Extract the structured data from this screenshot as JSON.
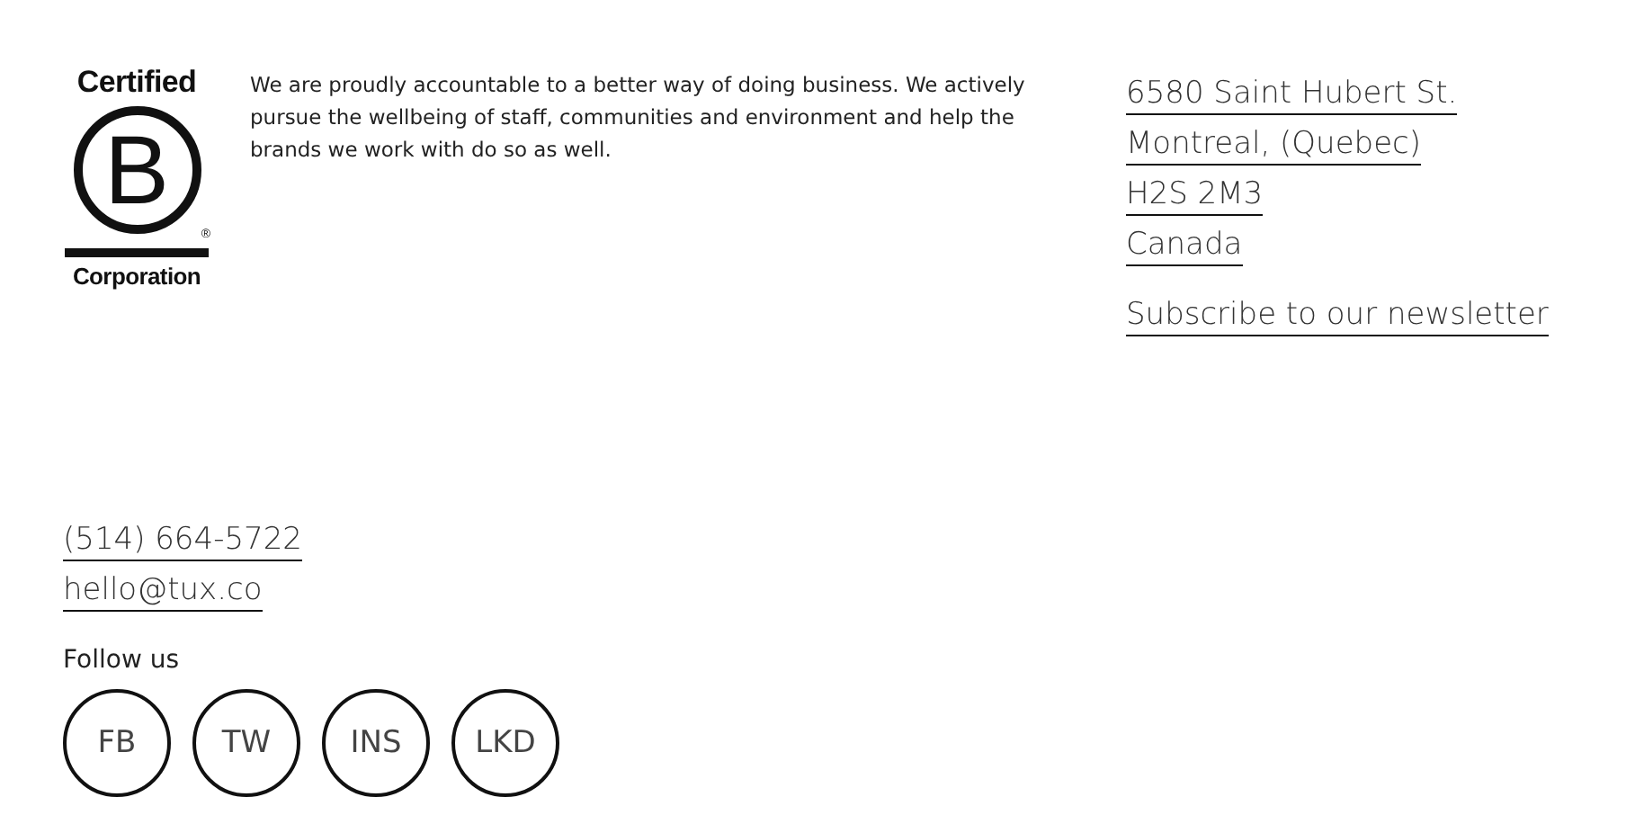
{
  "logo": {
    "top": "Certified",
    "letter": "B",
    "mark": "®",
    "bottom": "Corporation"
  },
  "statement": "We are proudly accountable to a better way of doing business. We actively pursue the wellbeing of staff, communities and environment and help the brands we work with do so as well.",
  "address": [
    "6580 Saint Hubert St.",
    "Montreal, (Quebec)",
    "H2S 2M3",
    "Canada"
  ],
  "newsletter": "Subscribe to our newsletter",
  "phone": "(514) 664-5722",
  "email": "hello@tux.co",
  "follow_title": "Follow us",
  "social": [
    "FB",
    "TW",
    "INS",
    "LKD"
  ]
}
